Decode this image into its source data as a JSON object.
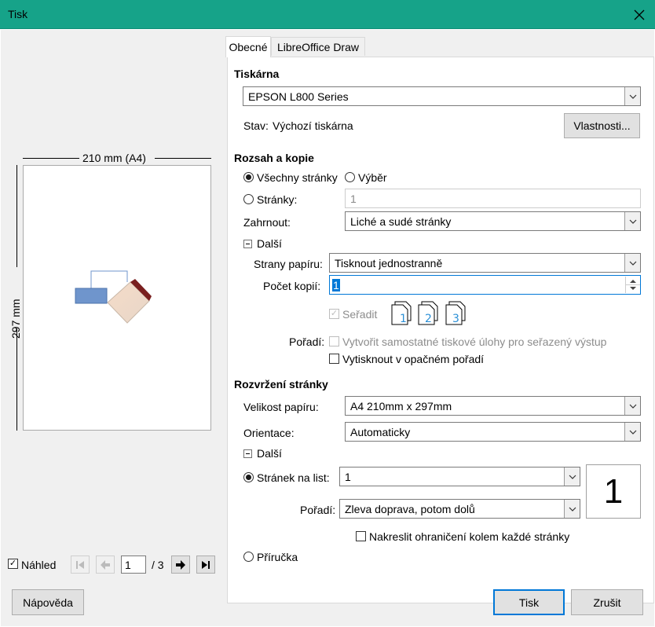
{
  "window": {
    "title": "Tisk"
  },
  "tabs": [
    {
      "label": "Obecné",
      "active": true
    },
    {
      "label": "LibreOffice Draw",
      "active": false
    }
  ],
  "preview": {
    "width_label": "210 mm (A4)",
    "height_label": "297 mm",
    "show_preview_label": "Náhled",
    "show_preview_checked": true,
    "page_current": "1",
    "page_total": "/ 3"
  },
  "printer": {
    "section_title": "Tiskárna",
    "selected": "EPSON L800 Series",
    "status_label": "Stav:",
    "status_value": "Výchozí tiskárna",
    "properties_button": "Vlastnosti..."
  },
  "range": {
    "section_title": "Rozsah a kopie",
    "all_pages_label": "Všechny stránky",
    "all_pages_selected": true,
    "selection_label": "Výběr",
    "pages_label": "Stránky:",
    "pages_value": "1",
    "include_label": "Zahrnout:",
    "include_value": "Liché a sudé stránky",
    "more_label": "Další",
    "paper_sides_label": "Strany papíru:",
    "paper_sides_value": "Tisknout jednostranně",
    "copies_label": "Počet kopií:",
    "copies_value": "1",
    "collate_label": "Seřadit",
    "collate_checked": true,
    "collate_icons": [
      "1",
      "2",
      "3"
    ],
    "order_label": "Pořadí:",
    "separate_jobs_label": "Vytvořit samostatné tiskové úlohy pro seřazený výstup",
    "reverse_order_label": "Vytisknout v opačném pořadí"
  },
  "layout": {
    "section_title": "Rozvržení stránky",
    "paper_size_label": "Velikost papíru:",
    "paper_size_value": "A4 210mm x 297mm",
    "orientation_label": "Orientace:",
    "orientation_value": "Automaticky",
    "more_label": "Další",
    "pages_per_sheet_label": "Stránek na list:",
    "pages_per_sheet_value": "1",
    "pages_per_sheet_selected": true,
    "pages_per_sheet_preview": "1",
    "order_label": "Pořadí:",
    "order_value": "Zleva doprava, potom dolů",
    "draw_border_label": "Nakreslit ohraničení kolem každé stránky",
    "brochure_label": "Příručka"
  },
  "footer": {
    "help_button": "Nápověda",
    "print_button": "Tisk",
    "cancel_button": "Zrušit"
  },
  "colors": {
    "titlebar": "#16a389",
    "accent": "#0078d7",
    "shape_fill": "#6f95cc",
    "shape_gradient": "#f5dcc8",
    "shape_edge": "#7a1f1f"
  },
  "icons": [
    "close-icon",
    "first-page-icon",
    "prev-page-icon",
    "next-page-icon",
    "last-page-icon",
    "chevron-down-icon",
    "collate-page-icon"
  ]
}
